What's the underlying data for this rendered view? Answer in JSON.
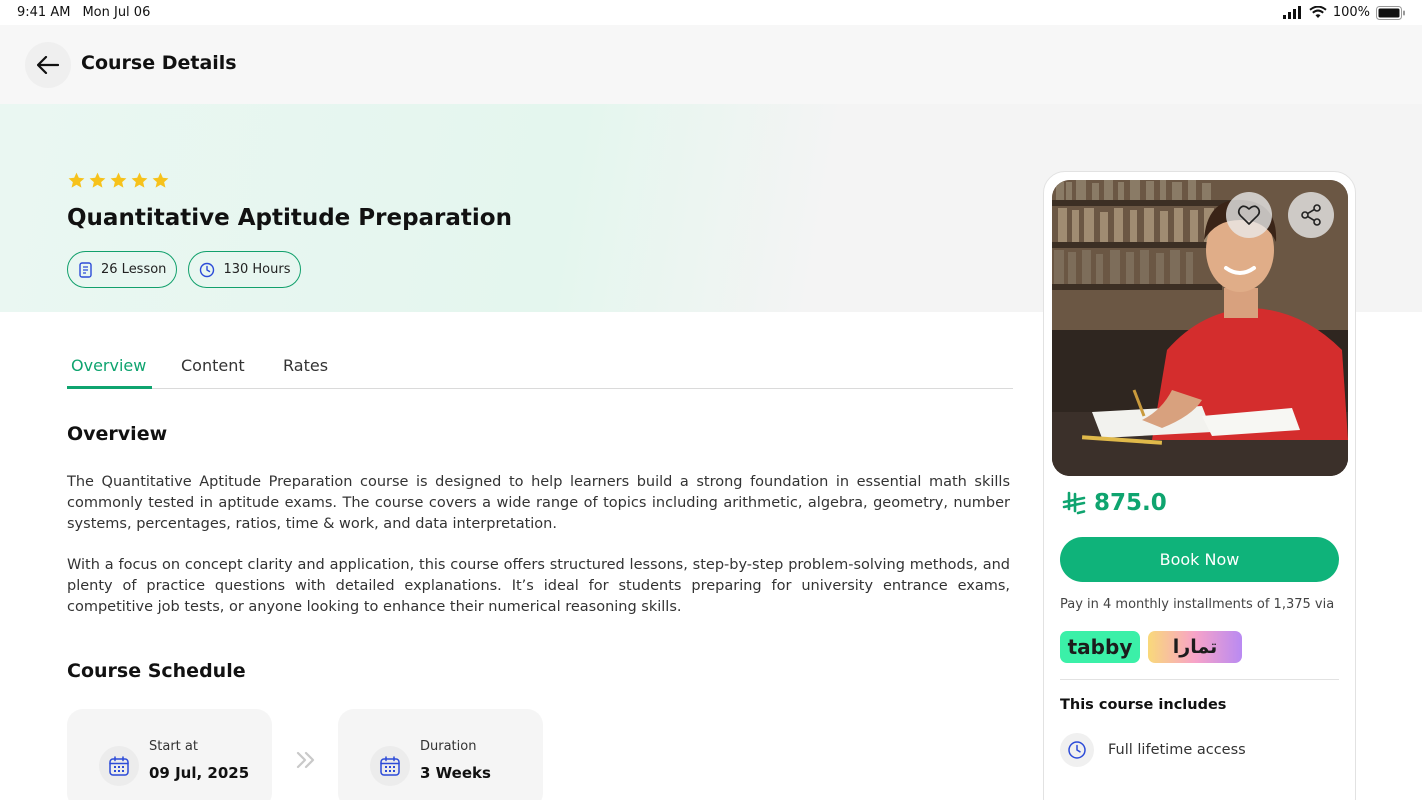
{
  "status_bar": {
    "time": "9:41 AM",
    "date": "Mon Jul 06",
    "battery": "100%"
  },
  "header": {
    "title": "Course Details"
  },
  "course": {
    "rating_stars": 5,
    "title": "Quantitative Aptitude Preparation",
    "lessons": "26 Lesson",
    "hours": "130 Hours"
  },
  "tabs": [
    {
      "label": "Overview",
      "active": true
    },
    {
      "label": "Content",
      "active": false
    },
    {
      "label": "Rates",
      "active": false
    }
  ],
  "overview": {
    "heading": "Overview",
    "paragraph1": "The Quantitative Aptitude Preparation course is designed to help learners build a strong foundation in essential math skills commonly tested in aptitude exams. The course covers a wide range of topics including arithmetic, algebra, geometry, number systems, percentages, ratios, time & work, and data interpretation.",
    "paragraph2": "With a focus on concept clarity and application, this course offers structured lessons, step-by-step problem-solving methods, and plenty of practice questions with detailed explanations. It’s ideal for students preparing for university entrance exams, competitive job tests, or anyone looking to enhance their numerical reasoning skills."
  },
  "schedule": {
    "heading": "Course Schedule",
    "start_label": "Start at",
    "start_value": "09 Jul, 2025",
    "duration_label": "Duration",
    "duration_value": "3 Weeks"
  },
  "sidebar": {
    "price": "875.0",
    "book_label": "Book Now",
    "installments": "Pay in 4 monthly installments of 1,375 via",
    "tabby_label": "tabby",
    "tamara_label": "تمارا",
    "includes_title": "This course includes",
    "includes": [
      {
        "label": "Full lifetime access"
      }
    ]
  },
  "colors": {
    "accent": "#0fa46f",
    "button": "#0fb37a",
    "star": "#f6c21b",
    "icon_blue": "#2c4bd8"
  }
}
